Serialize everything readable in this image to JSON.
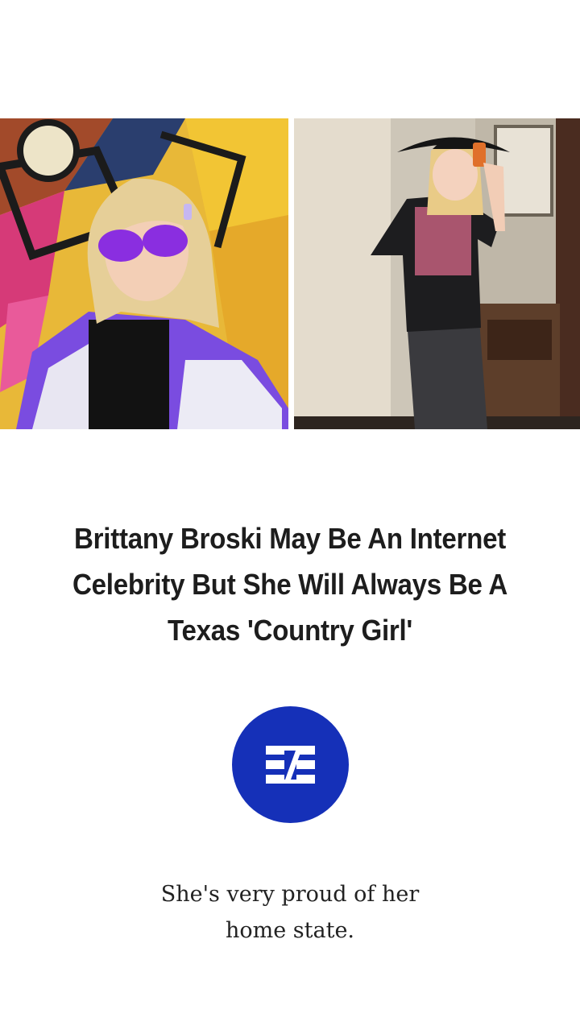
{
  "article": {
    "images": [
      {
        "icon": "photo-woman-purple-jacket-mural"
      },
      {
        "icon": "photo-woman-cowboy-hat-mirror-selfie"
      }
    ],
    "headline": "Brittany Broski May Be An Internet Celebrity But She Will Always Be A Texas 'Country Girl'",
    "publisher_logo": {
      "icon": "publisher-logo-icon",
      "color": "#1530b8"
    },
    "caption": "She's very proud of her home state."
  }
}
